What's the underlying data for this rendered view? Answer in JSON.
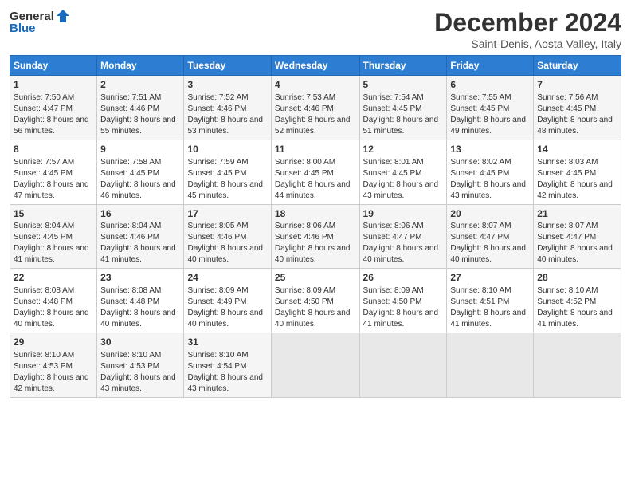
{
  "logo": {
    "general": "General",
    "blue": "Blue"
  },
  "title": "December 2024",
  "subtitle": "Saint-Denis, Aosta Valley, Italy",
  "days_of_week": [
    "Sunday",
    "Monday",
    "Tuesday",
    "Wednesday",
    "Thursday",
    "Friday",
    "Saturday"
  ],
  "weeks": [
    [
      {
        "day": 1,
        "sunrise": "Sunrise: 7:50 AM",
        "sunset": "Sunset: 4:47 PM",
        "daylight": "Daylight: 8 hours and 56 minutes."
      },
      {
        "day": 2,
        "sunrise": "Sunrise: 7:51 AM",
        "sunset": "Sunset: 4:46 PM",
        "daylight": "Daylight: 8 hours and 55 minutes."
      },
      {
        "day": 3,
        "sunrise": "Sunrise: 7:52 AM",
        "sunset": "Sunset: 4:46 PM",
        "daylight": "Daylight: 8 hours and 53 minutes."
      },
      {
        "day": 4,
        "sunrise": "Sunrise: 7:53 AM",
        "sunset": "Sunset: 4:46 PM",
        "daylight": "Daylight: 8 hours and 52 minutes."
      },
      {
        "day": 5,
        "sunrise": "Sunrise: 7:54 AM",
        "sunset": "Sunset: 4:45 PM",
        "daylight": "Daylight: 8 hours and 51 minutes."
      },
      {
        "day": 6,
        "sunrise": "Sunrise: 7:55 AM",
        "sunset": "Sunset: 4:45 PM",
        "daylight": "Daylight: 8 hours and 49 minutes."
      },
      {
        "day": 7,
        "sunrise": "Sunrise: 7:56 AM",
        "sunset": "Sunset: 4:45 PM",
        "daylight": "Daylight: 8 hours and 48 minutes."
      }
    ],
    [
      {
        "day": 8,
        "sunrise": "Sunrise: 7:57 AM",
        "sunset": "Sunset: 4:45 PM",
        "daylight": "Daylight: 8 hours and 47 minutes."
      },
      {
        "day": 9,
        "sunrise": "Sunrise: 7:58 AM",
        "sunset": "Sunset: 4:45 PM",
        "daylight": "Daylight: 8 hours and 46 minutes."
      },
      {
        "day": 10,
        "sunrise": "Sunrise: 7:59 AM",
        "sunset": "Sunset: 4:45 PM",
        "daylight": "Daylight: 8 hours and 45 minutes."
      },
      {
        "day": 11,
        "sunrise": "Sunrise: 8:00 AM",
        "sunset": "Sunset: 4:45 PM",
        "daylight": "Daylight: 8 hours and 44 minutes."
      },
      {
        "day": 12,
        "sunrise": "Sunrise: 8:01 AM",
        "sunset": "Sunset: 4:45 PM",
        "daylight": "Daylight: 8 hours and 43 minutes."
      },
      {
        "day": 13,
        "sunrise": "Sunrise: 8:02 AM",
        "sunset": "Sunset: 4:45 PM",
        "daylight": "Daylight: 8 hours and 43 minutes."
      },
      {
        "day": 14,
        "sunrise": "Sunrise: 8:03 AM",
        "sunset": "Sunset: 4:45 PM",
        "daylight": "Daylight: 8 hours and 42 minutes."
      }
    ],
    [
      {
        "day": 15,
        "sunrise": "Sunrise: 8:04 AM",
        "sunset": "Sunset: 4:45 PM",
        "daylight": "Daylight: 8 hours and 41 minutes."
      },
      {
        "day": 16,
        "sunrise": "Sunrise: 8:04 AM",
        "sunset": "Sunset: 4:46 PM",
        "daylight": "Daylight: 8 hours and 41 minutes."
      },
      {
        "day": 17,
        "sunrise": "Sunrise: 8:05 AM",
        "sunset": "Sunset: 4:46 PM",
        "daylight": "Daylight: 8 hours and 40 minutes."
      },
      {
        "day": 18,
        "sunrise": "Sunrise: 8:06 AM",
        "sunset": "Sunset: 4:46 PM",
        "daylight": "Daylight: 8 hours and 40 minutes."
      },
      {
        "day": 19,
        "sunrise": "Sunrise: 8:06 AM",
        "sunset": "Sunset: 4:47 PM",
        "daylight": "Daylight: 8 hours and 40 minutes."
      },
      {
        "day": 20,
        "sunrise": "Sunrise: 8:07 AM",
        "sunset": "Sunset: 4:47 PM",
        "daylight": "Daylight: 8 hours and 40 minutes."
      },
      {
        "day": 21,
        "sunrise": "Sunrise: 8:07 AM",
        "sunset": "Sunset: 4:47 PM",
        "daylight": "Daylight: 8 hours and 40 minutes."
      }
    ],
    [
      {
        "day": 22,
        "sunrise": "Sunrise: 8:08 AM",
        "sunset": "Sunset: 4:48 PM",
        "daylight": "Daylight: 8 hours and 40 minutes."
      },
      {
        "day": 23,
        "sunrise": "Sunrise: 8:08 AM",
        "sunset": "Sunset: 4:48 PM",
        "daylight": "Daylight: 8 hours and 40 minutes."
      },
      {
        "day": 24,
        "sunrise": "Sunrise: 8:09 AM",
        "sunset": "Sunset: 4:49 PM",
        "daylight": "Daylight: 8 hours and 40 minutes."
      },
      {
        "day": 25,
        "sunrise": "Sunrise: 8:09 AM",
        "sunset": "Sunset: 4:50 PM",
        "daylight": "Daylight: 8 hours and 40 minutes."
      },
      {
        "day": 26,
        "sunrise": "Sunrise: 8:09 AM",
        "sunset": "Sunset: 4:50 PM",
        "daylight": "Daylight: 8 hours and 41 minutes."
      },
      {
        "day": 27,
        "sunrise": "Sunrise: 8:10 AM",
        "sunset": "Sunset: 4:51 PM",
        "daylight": "Daylight: 8 hours and 41 minutes."
      },
      {
        "day": 28,
        "sunrise": "Sunrise: 8:10 AM",
        "sunset": "Sunset: 4:52 PM",
        "daylight": "Daylight: 8 hours and 41 minutes."
      }
    ],
    [
      {
        "day": 29,
        "sunrise": "Sunrise: 8:10 AM",
        "sunset": "Sunset: 4:53 PM",
        "daylight": "Daylight: 8 hours and 42 minutes."
      },
      {
        "day": 30,
        "sunrise": "Sunrise: 8:10 AM",
        "sunset": "Sunset: 4:53 PM",
        "daylight": "Daylight: 8 hours and 43 minutes."
      },
      {
        "day": 31,
        "sunrise": "Sunrise: 8:10 AM",
        "sunset": "Sunset: 4:54 PM",
        "daylight": "Daylight: 8 hours and 43 minutes."
      },
      null,
      null,
      null,
      null
    ]
  ]
}
